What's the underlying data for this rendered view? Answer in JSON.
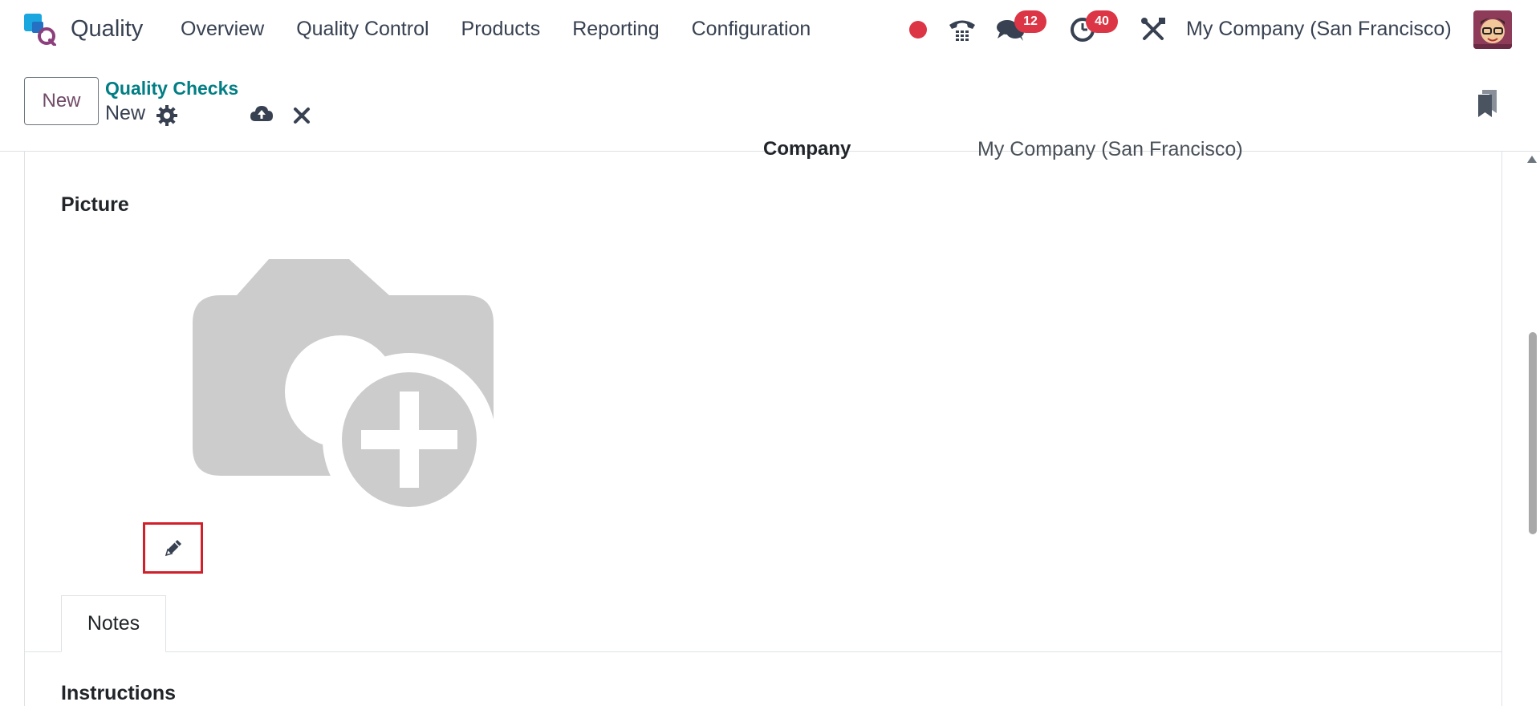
{
  "navbar": {
    "app_name": "Quality",
    "menu": [
      "Overview",
      "Quality Control",
      "Products",
      "Reporting",
      "Configuration"
    ],
    "messages_count": "12",
    "activities_count": "40",
    "company": "My Company (San Francisco)",
    "recording_color": "#dc3545"
  },
  "control_panel": {
    "new_label": "New",
    "breadcrumb": "Quality Checks",
    "record_name": "New"
  },
  "form": {
    "company_label": "Company",
    "company_value": "My Company (San Francisco)",
    "picture_label": "Picture",
    "tabs": [
      "Notes"
    ],
    "instructions_label": "Instructions"
  },
  "colors": {
    "brand": "#714b67",
    "link": "#017e84",
    "badge": "#dc3545",
    "highlight": "#d0202a"
  }
}
